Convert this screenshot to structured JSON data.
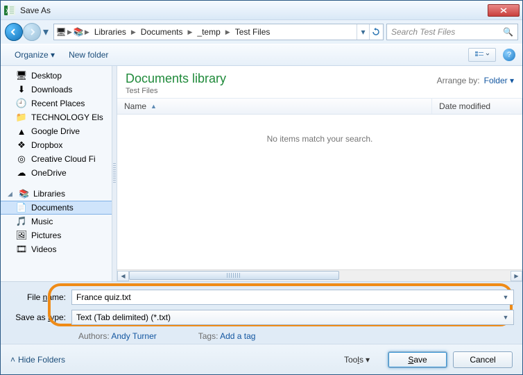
{
  "window": {
    "title": "Save As"
  },
  "breadcrumb": {
    "segments": [
      "Libraries",
      "Documents",
      "_temp",
      "Test Files"
    ]
  },
  "search": {
    "placeholder": "Search Test Files"
  },
  "toolbar": {
    "organize": "Organize",
    "newfolder": "New folder"
  },
  "sidebar": {
    "favorites": [
      {
        "icon": "🖥",
        "label": "Desktop"
      },
      {
        "icon": "⬇",
        "label": "Downloads"
      },
      {
        "icon": "🕘",
        "label": "Recent Places"
      },
      {
        "icon": "📁",
        "label": "TECHNOLOGY Els"
      },
      {
        "icon": "▲",
        "label": "Google Drive"
      },
      {
        "icon": "❖",
        "label": "Dropbox"
      },
      {
        "icon": "◎",
        "label": "Creative Cloud Fi"
      },
      {
        "icon": "☁",
        "label": "OneDrive"
      }
    ],
    "libraries_head": "Libraries",
    "libraries": [
      {
        "icon": "📄",
        "label": "Documents",
        "selected": true
      },
      {
        "icon": "🎵",
        "label": "Music"
      },
      {
        "icon": "🖼",
        "label": "Pictures"
      },
      {
        "icon": "🎞",
        "label": "Videos"
      }
    ]
  },
  "library": {
    "title": "Documents library",
    "subtitle": "Test Files",
    "arrange_label": "Arrange by:",
    "arrange_value": "Folder",
    "col_name": "Name",
    "col_date": "Date modified",
    "empty": "No items match your search."
  },
  "form": {
    "filename_label": "File name:",
    "filename_value": "France quiz.txt",
    "savetype_label": "Save as type:",
    "savetype_value": "Text (Tab delimited) (*.txt)",
    "authors_label": "Authors:",
    "authors_value": "Andy Turner",
    "tags_label": "Tags:",
    "tags_value": "Add a tag"
  },
  "bottom": {
    "hidefolders": "Hide Folders",
    "tools": "Tools",
    "save": "Save",
    "cancel": "Cancel"
  }
}
